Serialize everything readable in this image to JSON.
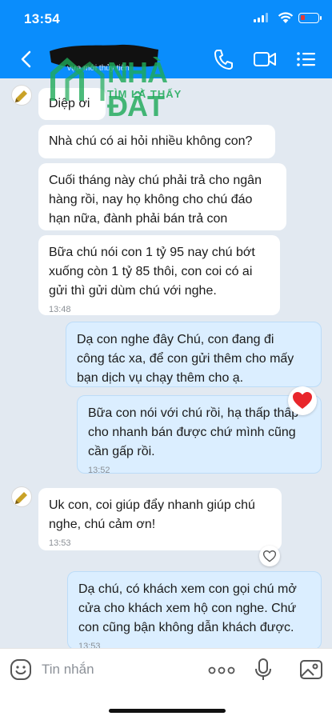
{
  "status": {
    "time": "13:54"
  },
  "header": {
    "contact_name": "vựa mới thủy tiên",
    "back_label": "Back"
  },
  "watermark": {
    "brand": "NHÀ ĐẤT",
    "slogan": "TÌM LÀ THẤY"
  },
  "messages": [
    {
      "from": "contact",
      "text": "Diệp ơi",
      "time": ""
    },
    {
      "from": "contact",
      "text": "Nhà chú có ai hỏi nhiều không con?",
      "time": ""
    },
    {
      "from": "contact",
      "lines": [
        "Cuối tháng này chú phải trả cho ngân",
        "hàng rồi, nay họ không cho chú đáo",
        "hạn nữa, đành phải bán trả con"
      ],
      "time": ""
    },
    {
      "from": "contact",
      "lines": [
        "Bữa chú nói con 1 tỷ 95 nay chú bớt",
        "xuống còn 1 tỷ 85 thôi, con coi có ai",
        "gửi thì gửi dùm chú với nghe."
      ],
      "time": "13:48"
    },
    {
      "from": "me",
      "lines": [
        "Dạ con nghe đây Chú, con đang đi",
        "công tác xa, để con gửi thêm cho mấy",
        "bạn dịch vụ chạy thêm cho ạ."
      ],
      "time": ""
    },
    {
      "from": "me",
      "lines": [
        "Bữa con nói với chú rồi, hạ thấp thấp",
        "cho nhanh bán được chứ mình cũng",
        "cần gấp rồi."
      ],
      "time": "13:52",
      "reaction": "heart-red"
    },
    {
      "from": "contact",
      "lines": [
        "Uk con, coi giúp đẩy nhanh giúp chú",
        "nghe, chú cảm ơn!"
      ],
      "time": "13:53",
      "reaction": "heart-outline"
    },
    {
      "from": "me",
      "lines": [
        "Dạ chú, có khách xem con gọi chú mở",
        "cửa cho khách xem hộ con nghe. Chứ",
        "con cũng bận không dẫn khách được."
      ],
      "time": "13:53"
    }
  ],
  "input": {
    "placeholder": "Tin nhắn"
  },
  "icons": {
    "back": "chevron-left-icon",
    "call": "phone-icon",
    "video": "video-camera-icon",
    "menu": "list-icon",
    "emoji": "emoji-icon",
    "more": "more-dots-icon",
    "mic": "microphone-icon",
    "image": "image-icon"
  },
  "colors": {
    "header": "#0a8dfc",
    "chat_bg": "#e2e9f1",
    "outgoing": "#dbeeff",
    "incoming": "#ffffff",
    "watermark": "#1faa59"
  }
}
